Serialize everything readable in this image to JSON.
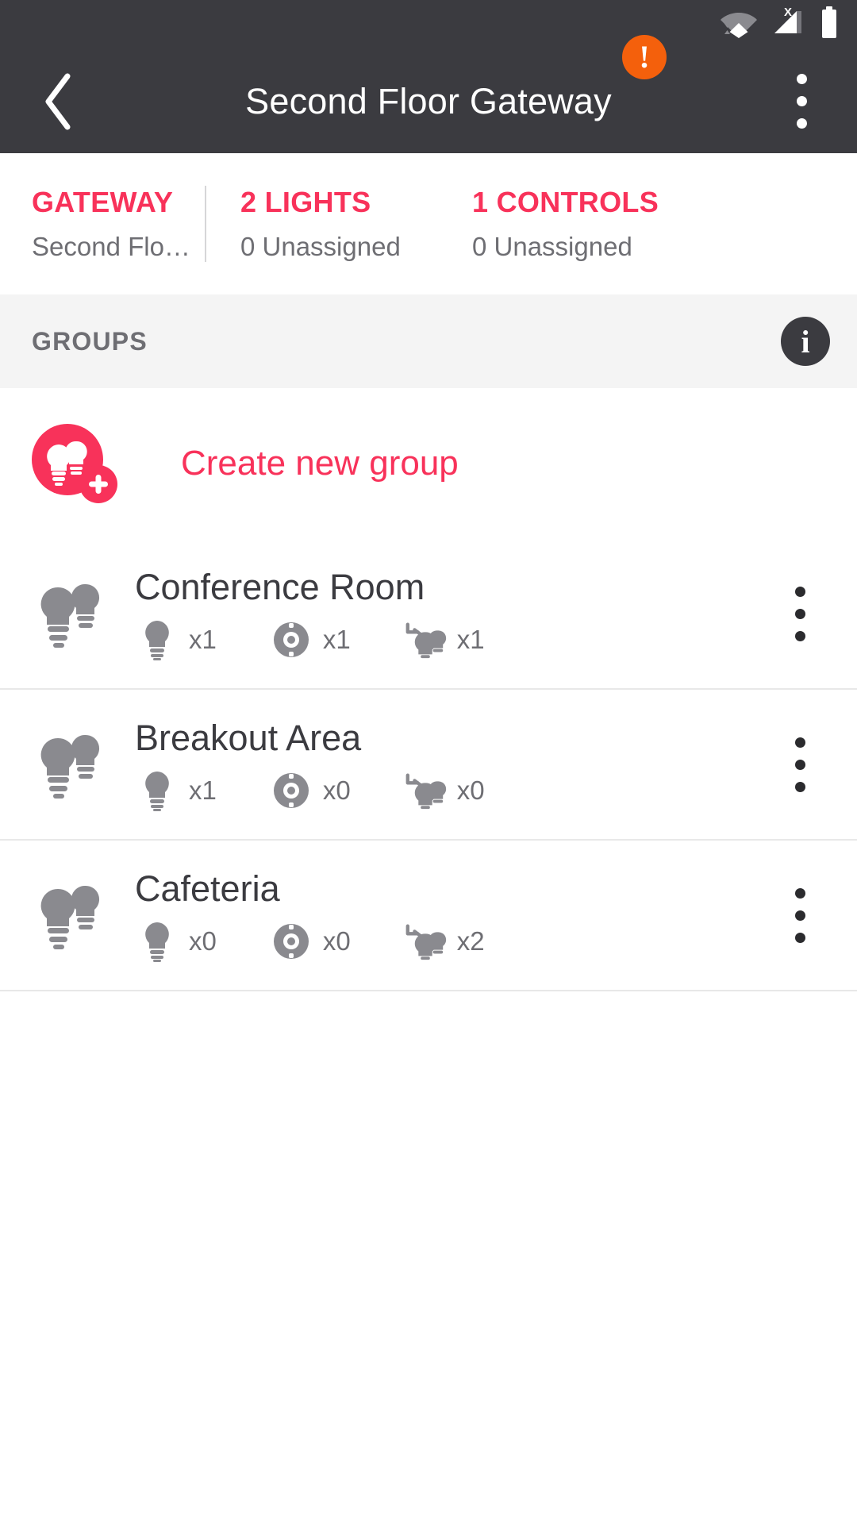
{
  "statusbar": {
    "icons": [
      {
        "name": "wifi-icon",
        "label": "wifi"
      },
      {
        "name": "cellular-signal-no-service-icon",
        "label": "X"
      },
      {
        "name": "battery-icon",
        "label": "battery"
      }
    ]
  },
  "appbar": {
    "back_label": "back",
    "title": "Second Floor Gateway",
    "alert_badge": "!",
    "alert_color": "#f4600c",
    "overflow_label": "more options"
  },
  "stats": [
    {
      "title": "GATEWAY",
      "subtitle": "Second Flo…"
    },
    {
      "title": "2 LIGHTS",
      "subtitle": "0 Unassigned"
    },
    {
      "title": "1 CONTROLS",
      "subtitle": "0 Unassigned"
    }
  ],
  "groups_header": {
    "label": "GROUPS",
    "info_glyph": "i"
  },
  "create_group": {
    "label": "Create new group",
    "icon": "add-group-bulbs-icon",
    "plus_glyph": "+"
  },
  "groups": [
    {
      "name": "Conference Room",
      "counts": [
        {
          "icon": "bulb-icon",
          "value": "x1"
        },
        {
          "icon": "sensor-dial-icon",
          "value": "x1"
        },
        {
          "icon": "scene-bulb-icon",
          "value": "x1"
        }
      ]
    },
    {
      "name": "Breakout Area",
      "counts": [
        {
          "icon": "bulb-icon",
          "value": "x1"
        },
        {
          "icon": "sensor-dial-icon",
          "value": "x0"
        },
        {
          "icon": "scene-bulb-icon",
          "value": "x0"
        }
      ]
    },
    {
      "name": "Cafeteria",
      "counts": [
        {
          "icon": "bulb-icon",
          "value": "x0"
        },
        {
          "icon": "sensor-dial-icon",
          "value": "x0"
        },
        {
          "icon": "scene-bulb-icon",
          "value": "x2"
        }
      ]
    }
  ],
  "colors": {
    "accent_pink": "#f8325a",
    "bar_dark": "#3b3b40",
    "alert_orange": "#f4600c",
    "band_gray": "#f4f4f4",
    "text_gray": "#6e6e73"
  }
}
